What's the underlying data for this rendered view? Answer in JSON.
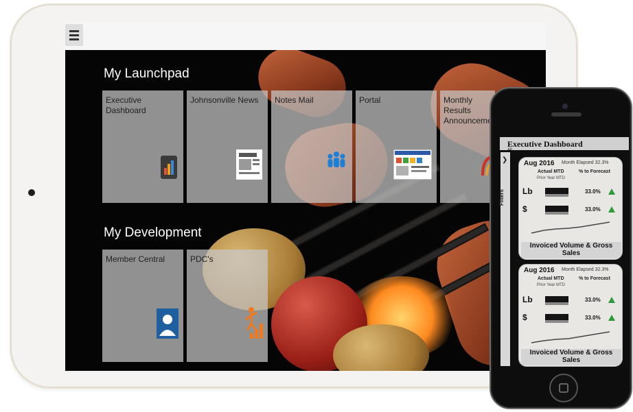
{
  "tablet": {
    "sections": [
      {
        "title": "My Launchpad",
        "tiles": [
          {
            "label": "Executive Dashboard",
            "icon": "bar-chart-icon"
          },
          {
            "label": "Johnsonville News",
            "icon": "newspaper-icon"
          },
          {
            "label": "Notes Mail",
            "icon": "people-icon"
          },
          {
            "label": "Portal",
            "icon": "portal-screenshot-icon"
          },
          {
            "label": "Monthly Results Announcement",
            "icon": "announcement-icon"
          }
        ]
      },
      {
        "title": "My Development",
        "tiles": [
          {
            "label": "Member Central",
            "icon": "person-icon"
          },
          {
            "label": "PDC's",
            "icon": "growth-icon"
          }
        ]
      }
    ]
  },
  "phone": {
    "title": "Executive Dashboard",
    "filter_value": "All",
    "filters_label": "Filters",
    "cards": [
      {
        "date": "Aug 2016",
        "month_elapsed": "Month Elapsed  32.3%",
        "actual_label": "Actual MTD",
        "prior_label": "Prior Year MTD",
        "forecast_label": "% to Forecast",
        "metrics": [
          {
            "label": "Lb",
            "pct": "33.0%"
          },
          {
            "label": "$",
            "pct": "33.0%"
          }
        ],
        "footer": "Invoiced Volume & Gross Sales"
      },
      {
        "date": "Aug 2016",
        "month_elapsed": "Month Elapsed  32.3%",
        "actual_label": "Actual MTD",
        "prior_label": "Prior Year MTD",
        "forecast_label": "% to Forecast",
        "metrics": [
          {
            "label": "Lb",
            "pct": "33.0%"
          },
          {
            "label": "$",
            "pct": "33.0%"
          }
        ],
        "footer": "Invoiced Volume & Gross Sales"
      }
    ]
  },
  "colors": {
    "screen_bg": "#050505",
    "tile_bg": "#c8c8c8",
    "trend_up": "#2e9a3a"
  }
}
